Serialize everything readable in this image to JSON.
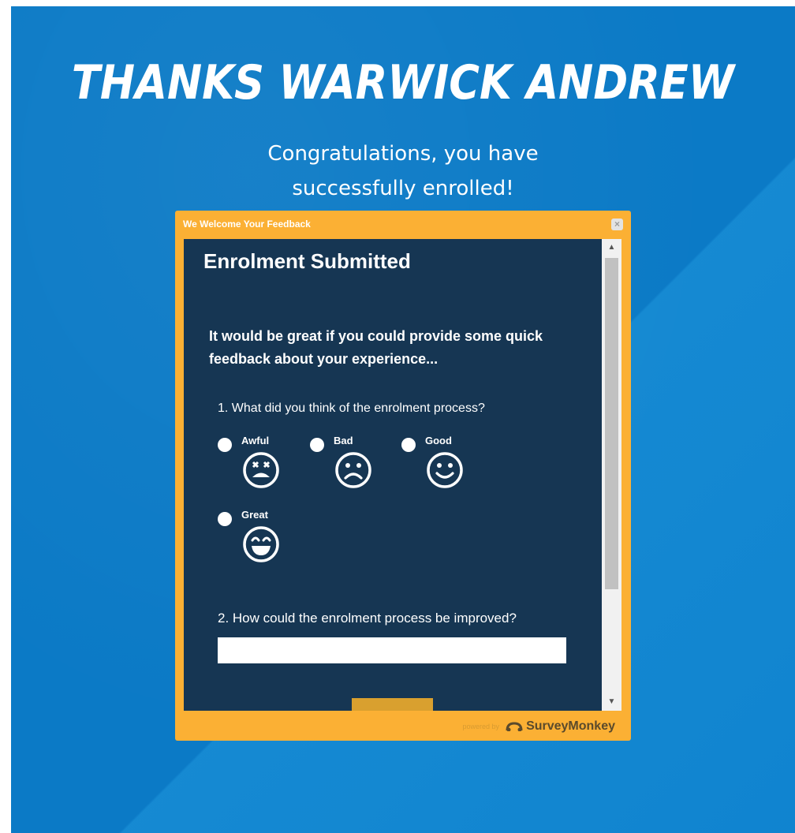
{
  "page": {
    "headline": "THANKS WARWICK ANDREW",
    "subtitle_line1": "Congratulations, you have",
    "subtitle_line2": "successfully enrolled!"
  },
  "widget": {
    "title": "We Welcome Your Feedback",
    "close_symbol": "×",
    "panel_title": "Enrolment Submitted",
    "intro": "It would be great if you could provide some quick feedback about your experience...",
    "question1": "1. What did you think of the enrolment process?",
    "options": [
      {
        "label": "Awful",
        "icon": "dizzy-face-icon"
      },
      {
        "label": "Bad",
        "icon": "sad-face-icon"
      },
      {
        "label": "Good",
        "icon": "smile-face-icon"
      },
      {
        "label": "Great",
        "icon": "laughing-face-icon"
      }
    ],
    "question2": "2. How could the enrolment process be improved?",
    "answer_value": "",
    "footer_powered": "powered by",
    "footer_brand": "SurveyMonkey"
  },
  "colors": {
    "background": "#0b7ac6",
    "widget_border": "#fbb034",
    "panel": "#163653",
    "submit": "#d9a02f"
  }
}
